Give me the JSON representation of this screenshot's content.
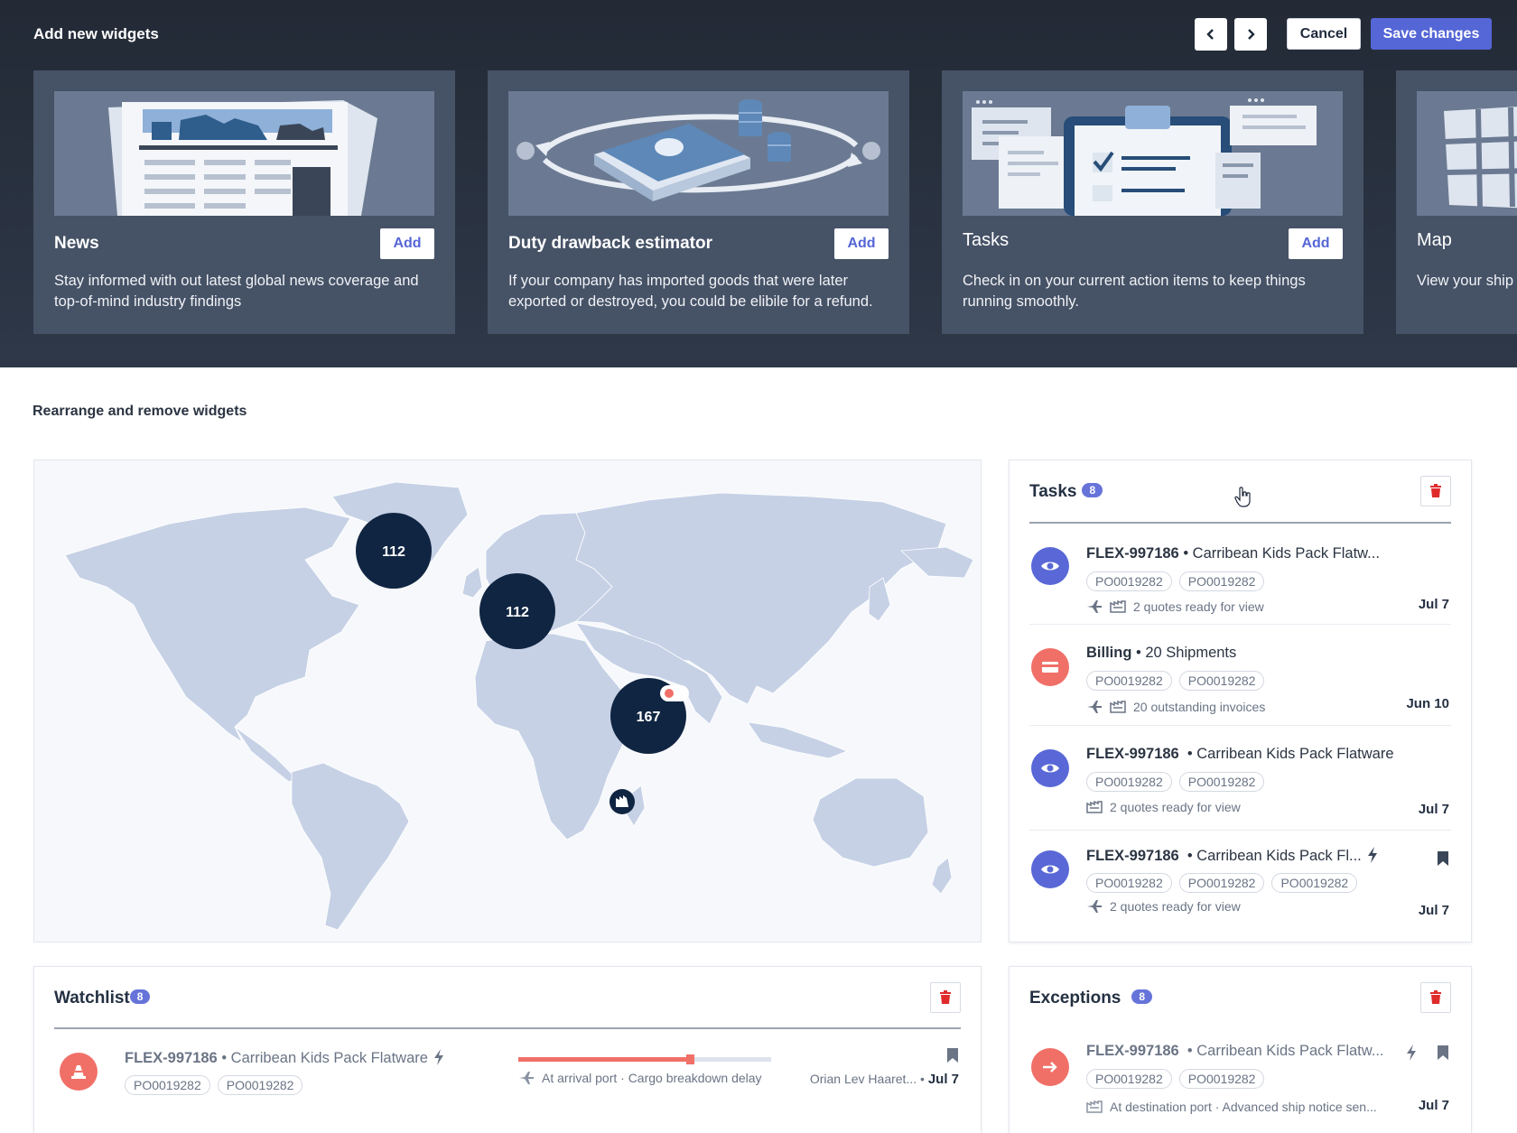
{
  "top": {
    "title": "Add new widgets",
    "cancel_label": "Cancel",
    "save_label": "Save changes"
  },
  "widgets": [
    {
      "name": "News",
      "add_label": "Add",
      "description": "Stay informed with out latest global news coverage and top-of-mind industry findings"
    },
    {
      "name": "Duty drawback estimator",
      "add_label": "Add",
      "description": "If your company has imported goods that were later exported or destroyed, you could be elibile for a refund."
    },
    {
      "name": "Tasks",
      "add_label": "Add",
      "description": "Check in on your current action items to keep things running smoothly."
    },
    {
      "name": "Map",
      "description": "View your ship milestones in"
    }
  ],
  "rearrange_title": "Rearrange and remove widgets",
  "map": {
    "clusters": [
      "112",
      "112",
      "167"
    ]
  },
  "tasks_panel": {
    "title": "Tasks",
    "count": "8",
    "items": [
      {
        "id": "FLEX-997186",
        "desc": " • Carribean Kids Pack Flatw...",
        "pos": [
          "PO0019282",
          "PO0019282"
        ],
        "meta": "2 quotes ready for view",
        "date": "Jul 7",
        "icon": "eye-icon"
      },
      {
        "id": "Billing",
        "desc": " • 20 Shipments",
        "pos": [
          "PO0019282",
          "PO0019282"
        ],
        "meta": "20 outstanding invoices",
        "date": "Jun 10",
        "icon": "credit-card-icon"
      },
      {
        "id": "FLEX-997186",
        "desc": "  • Carribean Kids Pack Flatware",
        "pos": [
          "PO0019282",
          "PO0019282"
        ],
        "meta": "2 quotes ready for view",
        "date": "Jul 7",
        "icon": "eye-icon"
      },
      {
        "id": "FLEX-997186",
        "desc": "  • Carribean Kids Pack Fl...",
        "pos": [
          "PO0019282",
          "PO0019282",
          "PO0019282"
        ],
        "meta": "2 quotes ready for view",
        "date": "Jul 7",
        "icon": "eye-icon"
      }
    ]
  },
  "watchlist": {
    "title": "Watchlist",
    "count": "8",
    "item": {
      "id": "FLEX-997186",
      "desc": " • Carribean Kids Pack Flatware",
      "pos": [
        "PO0019282",
        "PO0019282"
      ],
      "status": "At arrival port · Cargo breakdown delay",
      "progress": 0.68,
      "owner": "Orian Lev Haaret...",
      "date_sep": " • ",
      "date": "Jul 7"
    }
  },
  "exceptions": {
    "title": "Exceptions",
    "count": "8",
    "item": {
      "id": "FLEX-997186",
      "desc": "  • Carribean Kids Pack Flatw...",
      "pos": [
        "PO0019282",
        "PO0019282"
      ],
      "status": "At destination port · Advanced ship notice sen...",
      "date": "Jul 7"
    }
  },
  "colors": {
    "accent": "#5566d6",
    "danger": "#e02b2b",
    "map_land": "#c6d1e6",
    "cluster": "#102542"
  }
}
